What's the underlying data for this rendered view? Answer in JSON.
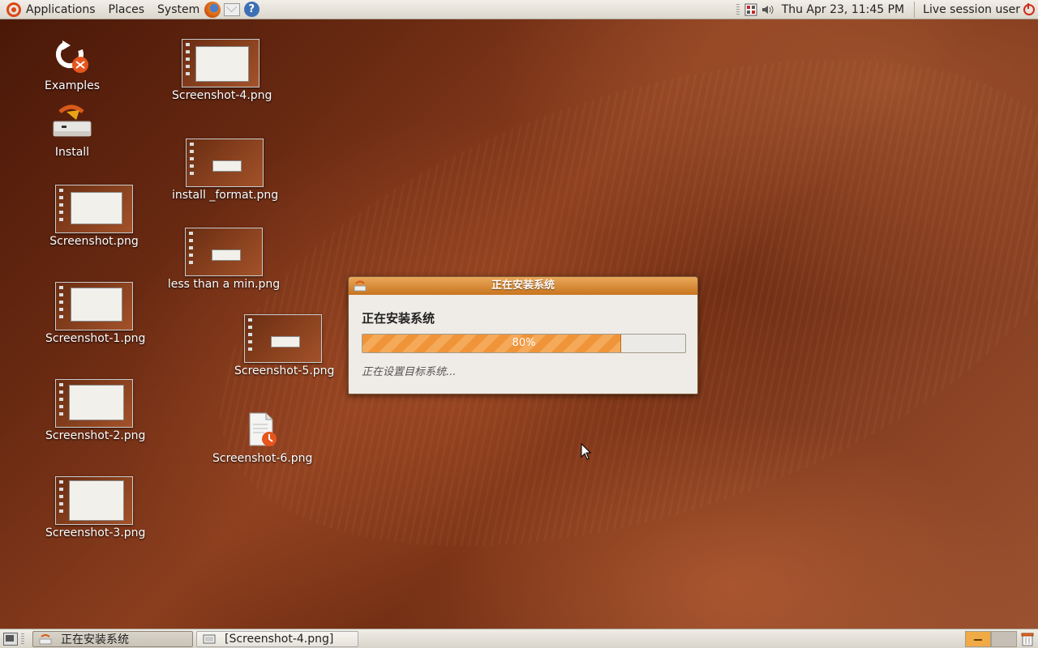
{
  "top_panel": {
    "menus": [
      "Applications",
      "Places",
      "System"
    ],
    "clock": "Thu Apr 23, 11:45 PM",
    "session_user": "Live session user"
  },
  "desktop_icons": [
    {
      "label": "Examples"
    },
    {
      "label": "Install"
    },
    {
      "label": "Screenshot.png"
    },
    {
      "label": "Screenshot-1.png"
    },
    {
      "label": "Screenshot-2.png"
    },
    {
      "label": "Screenshot-3.png"
    },
    {
      "label": "Screenshot-4.png"
    },
    {
      "label": "install _format.png"
    },
    {
      "label": "less than a min.png"
    },
    {
      "label": "Screenshot-5.png"
    },
    {
      "label": "Screenshot-6.png"
    }
  ],
  "dialog": {
    "title": "正在安装系统",
    "heading": "正在安装系统",
    "progress_percent": 80,
    "progress_label": "80%",
    "status": "正在设置目标系统..."
  },
  "taskbar": {
    "tasks": [
      {
        "label": "正在安装系统",
        "active": true
      },
      {
        "label": "[Screenshot-4.png]",
        "active": false
      }
    ],
    "workspaces": 2
  },
  "colors": {
    "accent_orange": "#f0943a",
    "titlebar_orange": "#c8741e",
    "panel_bg": "#e8e4dc"
  }
}
